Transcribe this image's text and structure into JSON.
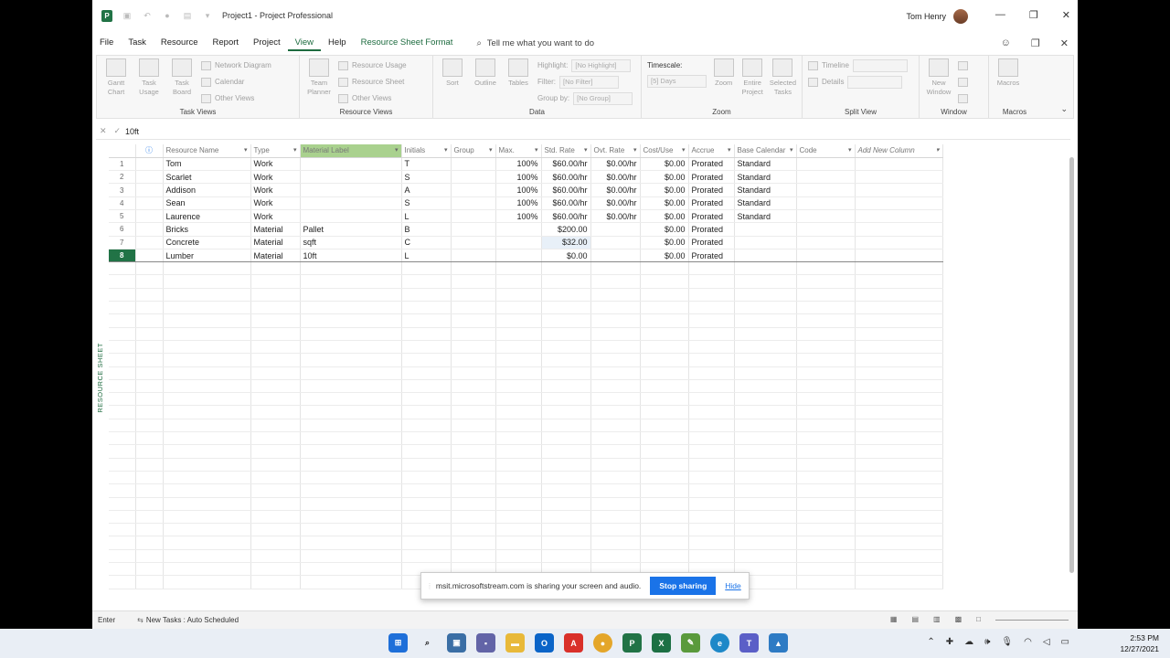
{
  "window": {
    "title": "Project1 - Project Professional",
    "user": "Tom Henry",
    "controls": [
      "—",
      "❐",
      "✕"
    ]
  },
  "menu": {
    "items": [
      "File",
      "Task",
      "Resource",
      "Report",
      "Project",
      "View",
      "Help"
    ],
    "active": "View",
    "format_tab": "Resource Sheet Format",
    "tell_me": "Tell me what you want to do"
  },
  "ribbon": {
    "task_views": {
      "label": "Task Views",
      "gantt": "Gantt Chart",
      "usage": "Task Usage",
      "board": "Task Board",
      "network": "Network Diagram",
      "calendar": "Calendar",
      "other": "Other Views"
    },
    "resource_views": {
      "label": "Resource Views",
      "planner": "Team Planner",
      "usage": "Resource Usage",
      "sheet": "Resource Sheet",
      "other": "Other Views"
    },
    "data": {
      "label": "Data",
      "sort": "Sort",
      "outline": "Outline",
      "tables": "Tables",
      "highlight": "Highlight:",
      "highlight_val": "[No Highlight]",
      "filter": "Filter:",
      "filter_val": "[No Filter]",
      "group": "Group by:",
      "group_val": "[No Group]"
    },
    "zoom": {
      "label": "Zoom",
      "timescale": "Timescale:",
      "timescale_val": "[5] Days",
      "zoom": "Zoom",
      "entire": "Entire Project",
      "selected": "Selected Tasks"
    },
    "split": {
      "label": "Split View",
      "timeline": "Timeline",
      "details": "Details"
    },
    "window": {
      "label": "Window",
      "new": "New Window"
    },
    "macros": {
      "label": "Macros",
      "macros": "Macros"
    }
  },
  "formula": {
    "value": "10ft"
  },
  "side_label": "RESOURCE SHEET",
  "columns": [
    "Resource Name",
    "Type",
    "Material Label",
    "Initials",
    "Group",
    "Max.",
    "Std. Rate",
    "Ovt. Rate",
    "Cost/Use",
    "Accrue",
    "Base Calendar",
    "Code",
    "Add New Column"
  ],
  "rows": [
    {
      "n": "1",
      "name": "Tom",
      "type": "Work",
      "label": "",
      "init": "T",
      "group": "",
      "max": "100%",
      "std": "$60.00/hr",
      "ovt": "$0.00/hr",
      "cost": "$0.00",
      "accrue": "Prorated",
      "cal": "Standard"
    },
    {
      "n": "2",
      "name": "Scarlet",
      "type": "Work",
      "label": "",
      "init": "S",
      "group": "",
      "max": "100%",
      "std": "$60.00/hr",
      "ovt": "$0.00/hr",
      "cost": "$0.00",
      "accrue": "Prorated",
      "cal": "Standard"
    },
    {
      "n": "3",
      "name": "Addison",
      "type": "Work",
      "label": "",
      "init": "A",
      "group": "",
      "max": "100%",
      "std": "$60.00/hr",
      "ovt": "$0.00/hr",
      "cost": "$0.00",
      "accrue": "Prorated",
      "cal": "Standard"
    },
    {
      "n": "4",
      "name": "Sean",
      "type": "Work",
      "label": "",
      "init": "S",
      "group": "",
      "max": "100%",
      "std": "$60.00/hr",
      "ovt": "$0.00/hr",
      "cost": "$0.00",
      "accrue": "Prorated",
      "cal": "Standard"
    },
    {
      "n": "5",
      "name": "Laurence",
      "type": "Work",
      "label": "",
      "init": "L",
      "group": "",
      "max": "100%",
      "std": "$60.00/hr",
      "ovt": "$0.00/hr",
      "cost": "$0.00",
      "accrue": "Prorated",
      "cal": "Standard"
    },
    {
      "n": "6",
      "name": "Bricks",
      "type": "Material",
      "label": "Pallet",
      "init": "B",
      "group": "",
      "max": "",
      "std": "$200.00",
      "ovt": "",
      "cost": "$0.00",
      "accrue": "Prorated",
      "cal": ""
    },
    {
      "n": "7",
      "name": "Concrete",
      "type": "Material",
      "label": "sqft",
      "init": "C",
      "group": "",
      "max": "",
      "std": "$32.00",
      "ovt": "",
      "cost": "$0.00",
      "accrue": "Prorated",
      "cal": ""
    },
    {
      "n": "8",
      "name": "Lumber",
      "type": "Material",
      "label": "10ft",
      "init": "L",
      "group": "",
      "max": "",
      "std": "$0.00",
      "ovt": "",
      "cost": "$0.00",
      "accrue": "Prorated",
      "cal": ""
    }
  ],
  "share": {
    "message": "msit.microsoftstream.com is sharing your screen and audio.",
    "stop": "Stop sharing",
    "hide": "Hide"
  },
  "status": {
    "mode": "Enter",
    "new_tasks": "New Tasks : Auto Scheduled"
  },
  "clock": {
    "time": "2:53 PM",
    "date": "12/27/2021"
  },
  "colors": {
    "accent": "#217346",
    "selected_header": "#a9d18e",
    "share_button": "#1a73e8"
  }
}
